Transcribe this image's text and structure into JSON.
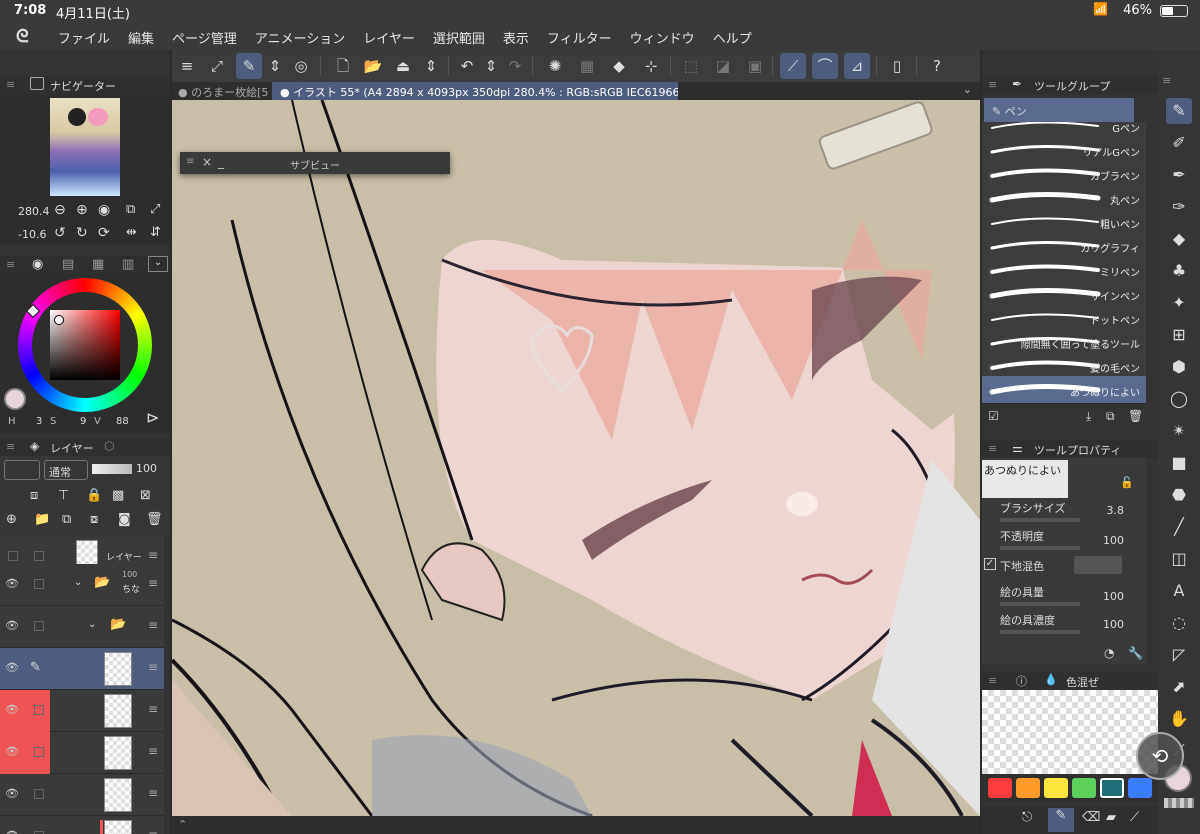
{
  "status": {
    "time": "7:08",
    "date": "4月11日(土)",
    "battery": "46%",
    "battery_level": 0.46
  },
  "menu": [
    "ファイル",
    "編集",
    "ページ管理",
    "アニメーション",
    "レイヤー",
    "選択範囲",
    "表示",
    "フィルター",
    "ウィンドウ",
    "ヘルプ"
  ],
  "tabs": {
    "tab1": "のろまー枚絵[5",
    "tab2": "イラスト 55* (A4 2894 x 4093px 350dpi 280.4% : RGB:sRGB IEC61966-2.1)"
  },
  "subview": {
    "title": "サブビュー"
  },
  "navigator": {
    "title": "ナビゲーター",
    "zoom": "280.4",
    "rotation": "-10.6"
  },
  "color": {
    "h": "3",
    "s": "9",
    "v": "88",
    "h_label": "H",
    "s_label": "S",
    "v_label": "V"
  },
  "layers": {
    "title": "レイヤー",
    "blend_mode": "通常",
    "opacity": "100",
    "rows": [
      {
        "label": "レイヤー"
      },
      {
        "label": "100\nちな"
      }
    ],
    "row0_text": "レイヤー",
    "row1_opacity": "100",
    "row1_name": "ちな"
  },
  "toolgroup": {
    "title": "ツールグループ",
    "selected": "ペン",
    "brushes": [
      "Gペン",
      "リアルGペン",
      "カブラペン",
      "丸ペン",
      "粗いペン",
      "カリグラフィ",
      "ミリペン",
      "サインペン",
      "ドットペン",
      "隙間無く囲って塗るツール",
      "髪の毛ペン",
      "あつぬりによい"
    ]
  },
  "toolprop": {
    "title": "ツールプロパティ",
    "brush_name": "あつぬりによい",
    "brush_size_label": "ブラシサイズ",
    "brush_size": "3.8",
    "opacity_label": "不透明度",
    "opacity": "100",
    "underlay_label": "下地混色",
    "paint_amount_label": "絵の具量",
    "paint_amount": "100",
    "paint_density_label": "絵の具濃度",
    "paint_density": "100"
  },
  "colormix": {
    "title": "色混ぜ"
  },
  "swatches": [
    "#ff3b3b",
    "#ff9a2a",
    "#ffe53b",
    "#5ed15a",
    "#1f6f7a",
    "#3b7dff"
  ]
}
